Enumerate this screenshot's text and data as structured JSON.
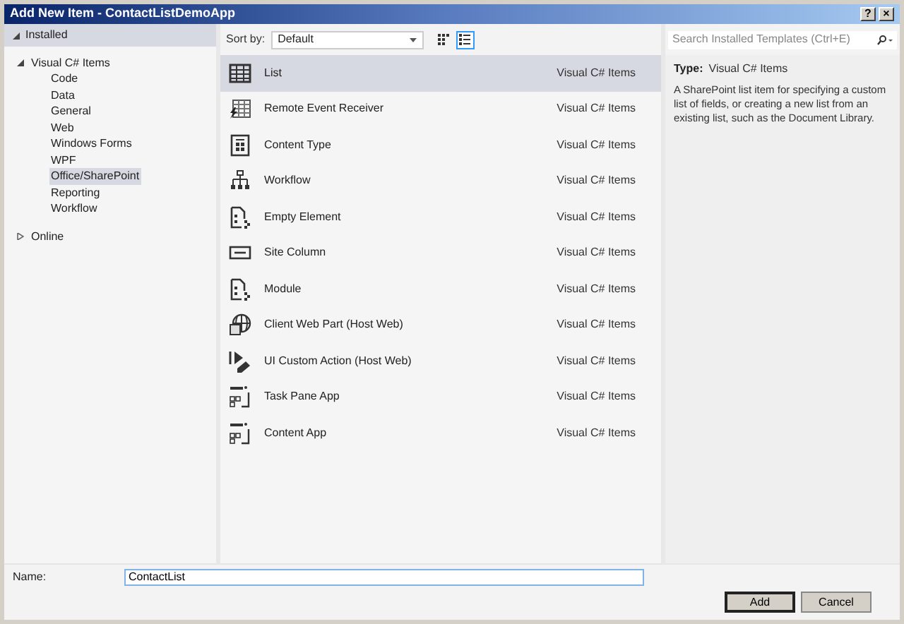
{
  "window": {
    "title": "Add New Item - ContactListDemoApp",
    "buttons": [
      "?",
      "×"
    ]
  },
  "tree": [
    {
      "label": "Installed",
      "kind": "header",
      "expanded": true,
      "children": [
        {
          "label": "Visual C# Items",
          "kind": "node",
          "expanded": true,
          "selected": false,
          "children": [
            {
              "label": "Code",
              "selected": false
            },
            {
              "label": "Data",
              "selected": false
            },
            {
              "label": "General",
              "selected": false
            },
            {
              "label": "Web",
              "selected": false
            },
            {
              "label": "Windows Forms",
              "selected": false
            },
            {
              "label": "WPF",
              "selected": false
            },
            {
              "label": "Office/SharePoint",
              "selected": true
            },
            {
              "label": "Reporting",
              "selected": false
            },
            {
              "label": "Workflow",
              "selected": false
            }
          ]
        }
      ]
    },
    {
      "label": "Online",
      "kind": "node",
      "expanded": false,
      "selected": false
    }
  ],
  "toolbar": {
    "sort_label": "Sort by:",
    "sort_value": "Default",
    "views": [
      {
        "kind": "tiles",
        "selected": false
      },
      {
        "kind": "list",
        "selected": true
      }
    ]
  },
  "templates": [
    {
      "name": "List",
      "category": "Visual C# Items",
      "kind": "list",
      "selected": true
    },
    {
      "name": "Remote Event Receiver",
      "category": "Visual C# Items",
      "kind": "receiver",
      "selected": false
    },
    {
      "name": "Content Type",
      "category": "Visual C# Items",
      "kind": "contenttype",
      "selected": false
    },
    {
      "name": "Workflow",
      "category": "Visual C# Items",
      "kind": "workflow",
      "selected": false
    },
    {
      "name": "Empty Element",
      "category": "Visual C# Items",
      "kind": "element",
      "selected": false
    },
    {
      "name": "Site Column",
      "category": "Visual C# Items",
      "kind": "column",
      "selected": false
    },
    {
      "name": "Module",
      "category": "Visual C# Items",
      "kind": "element",
      "selected": false
    },
    {
      "name": "Client Web Part (Host Web)",
      "category": "Visual C# Items",
      "kind": "webpart",
      "selected": false
    },
    {
      "name": "UI Custom Action (Host Web)",
      "category": "Visual C# Items",
      "kind": "action",
      "selected": false
    },
    {
      "name": "Task Pane App",
      "category": "Visual C# Items",
      "kind": "app",
      "selected": false
    },
    {
      "name": "Content App",
      "category": "Visual C# Items",
      "kind": "app",
      "selected": false
    }
  ],
  "search": {
    "placeholder": "Search Installed Templates (Ctrl+E)"
  },
  "details": {
    "type_label": "Type:",
    "type_value": "Visual C# Items",
    "description": "A SharePoint list item for specifying a custom list of fields, or creating a new list from an existing list, such as the Document Library."
  },
  "name_field": {
    "label": "Name:",
    "value": "ContactList"
  },
  "buttons": [
    {
      "label": "Add",
      "default": true
    },
    {
      "label": "Cancel",
      "default": false
    }
  ]
}
